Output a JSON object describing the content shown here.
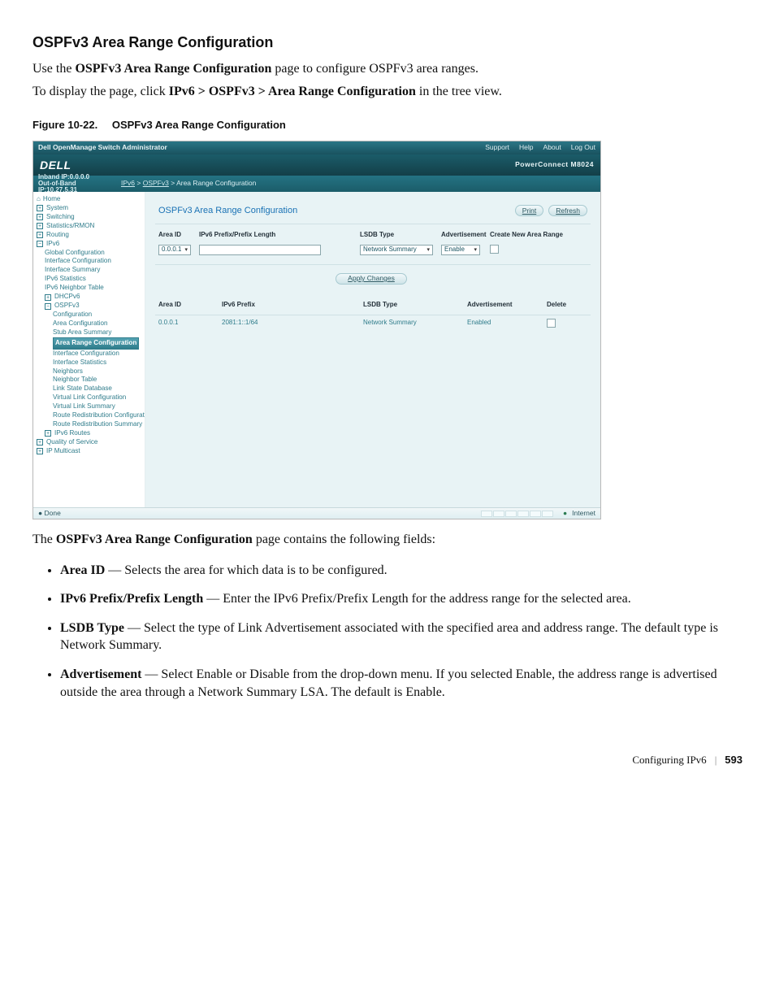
{
  "doc": {
    "heading": "OSPFv3 Area Range Configuration",
    "figure_caption_prefix": "Figure 10-22.",
    "figure_caption_title": "OSPFv3 Area Range Configuration",
    "intro_before_bold": "Use the ",
    "intro_bold": "OSPFv3 Area Range Configuration",
    "intro_after_bold": " page to configure OSPFv3 area ranges.",
    "nav_before_bold": "To display the page, click ",
    "nav_bold": "IPv6 > OSPFv3 > Area Range Configuration",
    "nav_after_bold": " in the tree view.",
    "after_before_bold": "The ",
    "after_bold": "OSPFv3 Area Range Configuration",
    "after_after_bold": " page contains the following fields:",
    "bullets": {
      "0": {
        "term": "Area ID",
        "text": " — Selects the area for which data is to be configured."
      },
      "1": {
        "term": "IPv6 Prefix/Prefix Length",
        "text": " — Enter the IPv6 Prefix/Prefix Length for the address range for the selected area."
      },
      "2": {
        "term": "LSDB Type",
        "text": " — Select the type of Link Advertisement associated with the specified area and address range. The default type is Network Summary."
      },
      "3": {
        "term": "Advertisement",
        "text": " — Select Enable or Disable from the drop-down menu. If you selected Enable, the address range is advertised outside the area through a Network Summary LSA. The default is Enable."
      }
    },
    "footer_label": "Configuring IPv6",
    "footer_sep": "|",
    "footer_page": "593"
  },
  "app": {
    "title": "Dell OpenManage Switch Administrator",
    "links": {
      "support": "Support",
      "help": "Help",
      "about": "About",
      "logout": "Log Out"
    },
    "brand": "DELL",
    "device": "PowerConnect M8024",
    "ip1": "Inband IP:0.0.0.0",
    "ip2": "Out-of-Band IP:10.27.5.31",
    "crumb_ipv6": "IPv6",
    "crumb_ospf": "OSPFv3",
    "crumb_tail": "Area Range Configuration",
    "tree": {
      "home": "Home",
      "system": "System",
      "switching": "Switching",
      "stats": "Statistics/RMON",
      "routing": "Routing",
      "ipv6": "IPv6",
      "global": "Global Configuration",
      "ifcfg": "Interface Configuration",
      "ifsum": "Interface Summary",
      "v6stats": "IPv6 Statistics",
      "v6neigh": "IPv6 Neighbor Table",
      "dhcp": "DHCPv6",
      "ospf": "OSPFv3",
      "conf": "Configuration",
      "area": "Area Configuration",
      "stub": "Stub Area Summary",
      "arc": "Area Range Configuration",
      "ifcfg2": "Interface Configuration",
      "ifstat": "Interface Statistics",
      "neigh": "Neighbors",
      "ntab": "Neighbor Table",
      "lsdb": "Link State Database",
      "vlcfg": "Virtual Link Configuration",
      "vlsum": "Virtual Link Summary",
      "rrc": "Route Redistribution Configuration",
      "rrs": "Route Redistribution Summary",
      "routes": "IPv6 Routes",
      "qos": "Quality of Service",
      "ipmc": "IP Multicast"
    },
    "panel": {
      "title": "OSPFv3 Area Range Configuration",
      "print": "Print",
      "refresh": "Refresh",
      "th_area": "Area ID",
      "th_prefix": "IPv6 Prefix/Prefix Length",
      "th_lsdb": "LSDB Type",
      "th_adv": "Advertisement",
      "th_create": "Create New Area Range",
      "sel_area": "0.0.0.1",
      "sel_lsdb": "Network Summary",
      "sel_adv": "Enable",
      "btn_apply": "Apply Changes",
      "tbl_area": "Area ID",
      "tbl_prefix": "IPv6 Prefix",
      "tbl_lsdb": "LSDB Type",
      "tbl_adv": "Advertisement",
      "tbl_del": "Delete",
      "row_area": "0.0.0.1",
      "row_prefix": "2081:1::1/64",
      "row_lsdb": "Network Summary",
      "row_adv": "Enabled"
    },
    "status": {
      "done": "Done",
      "internet": "Internet"
    }
  }
}
